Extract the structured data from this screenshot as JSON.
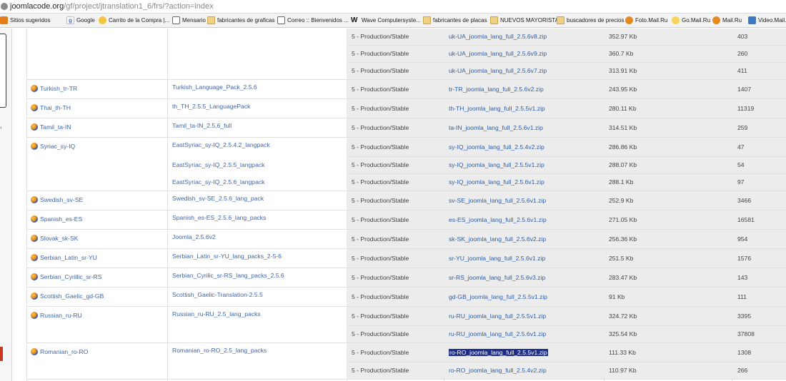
{
  "address_bar": {
    "host": "joomlacode.org",
    "path": "/gf/project/jtranslation1_6/frs/?action=index"
  },
  "bookmarks": [
    {
      "label": "Sitios sugeridos",
      "icon": "apps-icon"
    },
    {
      "label": "Google",
      "icon": "google-icon"
    },
    {
      "label": "Carrito de la Compra |...",
      "icon": "cart-icon"
    },
    {
      "label": "Mensario",
      "icon": "message-icon"
    },
    {
      "label": "fabricantes de graficas",
      "icon": "folder-icon"
    },
    {
      "label": "Correo :: Bienvenidos ...",
      "icon": "mail-icon"
    },
    {
      "label": "Wave Computersyste...",
      "icon": "wave-icon"
    },
    {
      "label": "fabricantes de placas",
      "icon": "folder-icon"
    },
    {
      "label": "NUEVOS MAYORISTAS",
      "icon": "folder-icon"
    },
    {
      "label": "buscadores de precios",
      "icon": "folder-icon"
    },
    {
      "label": "Foto.Mail.Ru",
      "icon": "mailru-icon"
    },
    {
      "label": "Go.Mail.Ru",
      "icon": "search-icon"
    },
    {
      "label": "Mail.Ru",
      "icon": "mailru-icon"
    },
    {
      "label": "Video.Mail.Ru",
      "icon": "video-icon"
    }
  ],
  "languages": [
    {
      "name": "",
      "package": "",
      "files": [
        {
          "status": "5 - Production/Stable",
          "file": "uk-UA_joomla_lang_full_2.5.6v8.zip",
          "size": "352.97 Kb",
          "downloads": "403"
        },
        {
          "status": "5 - Production/Stable",
          "file": "uk-UA_joomla_lang_full_2.5.6v9.zip",
          "size": "360.7 Kb",
          "downloads": "260"
        },
        {
          "status": "5 - Production/Stable",
          "file": "uk-UA_joomla_lang_full_2.5.6v7.zip",
          "size": "313.91 Kb",
          "downloads": "411"
        }
      ]
    },
    {
      "name": "Turkish_tr-TR",
      "package": "Turkish_Language_Pack_2.5.6",
      "files": [
        {
          "status": "5 - Production/Stable",
          "file": "tr-TR_joomla_lang_full_2.5.6v2.zip",
          "size": "243.95 Kb",
          "downloads": "1407"
        }
      ]
    },
    {
      "name": "Thai_th-TH",
      "package": "th_TH_2.5.5_LanguagePack",
      "files": [
        {
          "status": "5 - Production/Stable",
          "file": "th-TH_joomla_lang_full_2.5.5v1.zip",
          "size": "280.11 Kb",
          "downloads": "11319"
        }
      ]
    },
    {
      "name": "Tamil_ta-IN",
      "package": "Tamil_ta-IN_2.5.6_full",
      "files": [
        {
          "status": "5 - Production/Stable",
          "file": "ta-IN_joomla_lang_full_2.5.6v1.zip",
          "size": "314.51 Kb",
          "downloads": "259"
        }
      ]
    },
    {
      "name": "Syriac_sy-IQ",
      "package": "EastSyriac_sy-IQ_2.5.4.2_langpack",
      "files": [
        {
          "status": "5 - Production/Stable",
          "file": "sy-IQ_joomla_lang_full_2.5.4v2.zip",
          "size": "286.86 Kb",
          "downloads": "47"
        },
        {
          "status": "5 - Production/Stable",
          "file": "sy-IQ_joomla_lang_full_2.5.5v1.zip",
          "size": "288.07 Kb",
          "downloads": "54",
          "package": "EastSyriac_sy-IQ_2.5.5_langpack"
        },
        {
          "status": "5 - Production/Stable",
          "file": "sy-IQ_joomla_lang_full_2.5.6v1.zip",
          "size": "288.1 Kb",
          "downloads": "97",
          "package": "EastSyriac_sy-IQ_2.5.6_langpack"
        }
      ]
    },
    {
      "name": "Swedish_sv-SE",
      "package": "Swedish_sv-SE_2.5.6_lang_pack",
      "files": [
        {
          "status": "5 - Production/Stable",
          "file": "sv-SE_joomla_lang_full_2.5.6v1.zip",
          "size": "252.9 Kb",
          "downloads": "3466"
        }
      ]
    },
    {
      "name": "Spanish_es-ES",
      "package": "Spanish_es-ES_2.5.6_lang_packs",
      "files": [
        {
          "status": "5 - Production/Stable",
          "file": "es-ES_joomla_lang_full_2.5.6v1.zip",
          "size": "271.05 Kb",
          "downloads": "16581"
        }
      ]
    },
    {
      "name": "Slovak_sk-SK",
      "package": "Joomla_2.5.6v2",
      "files": [
        {
          "status": "5 - Production/Stable",
          "file": "sk-SK_joomla_lang_full_2.5.6v2.zip",
          "size": "256.36 Kb",
          "downloads": "954"
        }
      ]
    },
    {
      "name": "Serbian_Latin_sr-YU",
      "package": "Serbian_Latin_sr-YU_lang_packs_2-5-6",
      "files": [
        {
          "status": "5 - Production/Stable",
          "file": "sr-YU_joomla_lang_full_2.5.6v1.zip",
          "size": "251.5 Kb",
          "downloads": "1576"
        }
      ]
    },
    {
      "name": "Serbian_Cyrillic_sr-RS",
      "package": "Serbian_Cyrilic_sr-RS_lang_packs_2.5.6",
      "files": [
        {
          "status": "5 - Production/Stable",
          "file": "sr-RS_joomla_lang_full_2.5.6v3.zip",
          "size": "283.47 Kb",
          "downloads": "143"
        }
      ]
    },
    {
      "name": "Scottish_Gaelic_gd-GB",
      "package": "Scottish_Gaelic-Translation-2.5.5",
      "files": [
        {
          "status": "5 - Production/Stable",
          "file": "gd-GB_joomla_lang_full_2.5.5v1.zip",
          "size": "91 Kb",
          "downloads": "111"
        }
      ]
    },
    {
      "name": "Russian_ru-RU",
      "package": "Russian_ru-RU_2.5_lang_packs",
      "files": [
        {
          "status": "5 - Production/Stable",
          "file": "ru-RU_joomla_lang_full_2.5.5v1.zip",
          "size": "324.72 Kb",
          "downloads": "3395"
        },
        {
          "status": "5 - Production/Stable",
          "file": "ru-RU_joomla_lang_full_2.5.6v1.zip",
          "size": "325.54 Kb",
          "downloads": "37808"
        }
      ]
    },
    {
      "name": "Romanian_ro-RO",
      "package": "Romanian_ro-RO_2.5_lang_packs",
      "files": [
        {
          "status": "5 - Production/Stable",
          "file": "ro-RO_joomla_lang_full_2.5.5v1.zip",
          "size": "111.33 Kb",
          "downloads": "1308",
          "selected": true
        },
        {
          "status": "5 - Production/Stable",
          "file": "ro-RO_joomla_lang_full_2.5.4v2.zip",
          "size": "110.97 Kb",
          "downloads": "266"
        }
      ]
    }
  ]
}
